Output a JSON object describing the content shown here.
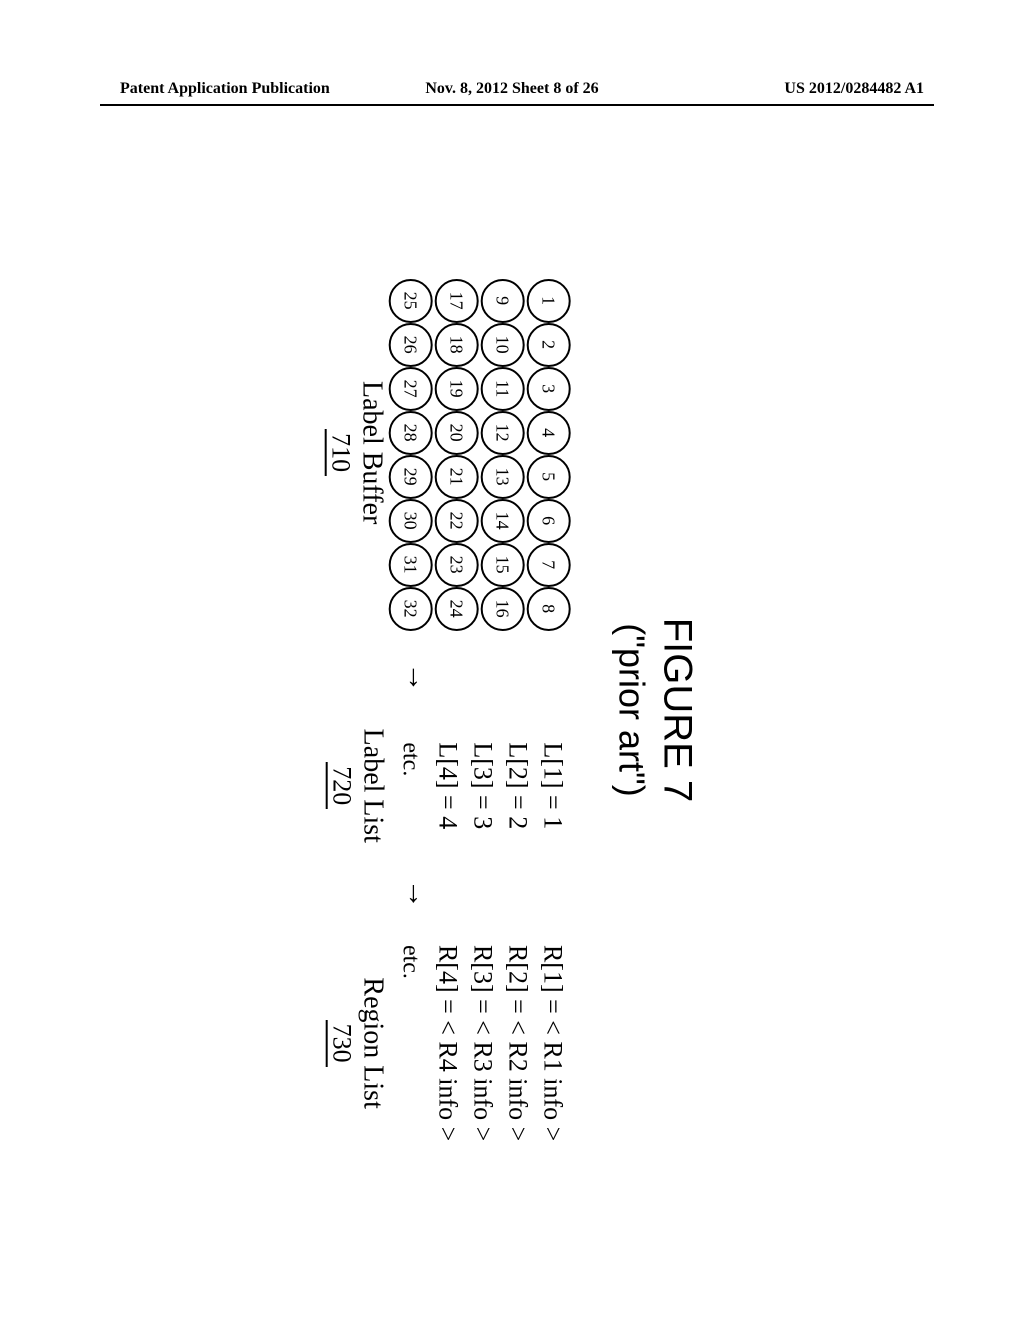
{
  "header": {
    "left": "Patent Application Publication",
    "center": "Nov. 8, 2012  Sheet 8 of 26",
    "right": "US 2012/0284482 A1"
  },
  "figure": {
    "title": "FIGURE 7",
    "subtitle": "(\"prior art\")",
    "label_buffer": {
      "caption": "Label Buffer",
      "ref": "710",
      "cells": [
        "1",
        "2",
        "3",
        "4",
        "5",
        "6",
        "7",
        "8",
        "9",
        "10",
        "11",
        "12",
        "13",
        "14",
        "15",
        "16",
        "17",
        "18",
        "19",
        "20",
        "21",
        "22",
        "23",
        "24",
        "25",
        "26",
        "27",
        "28",
        "29",
        "30",
        "31",
        "32"
      ]
    },
    "label_list": {
      "caption": "Label List",
      "ref": "720",
      "lines": [
        "L[1] = 1",
        "L[2] = 2",
        "L[3] = 3",
        "L[4] = 4"
      ],
      "etc": "etc."
    },
    "region_list": {
      "caption": "Region List",
      "ref": "730",
      "lines": [
        "R[1] = < R1 info >",
        "R[2] = < R2 info >",
        "R[3] = < R3 info >",
        "R[4] = < R4 info >"
      ],
      "etc": "etc."
    },
    "arrow_glyph": "→"
  }
}
